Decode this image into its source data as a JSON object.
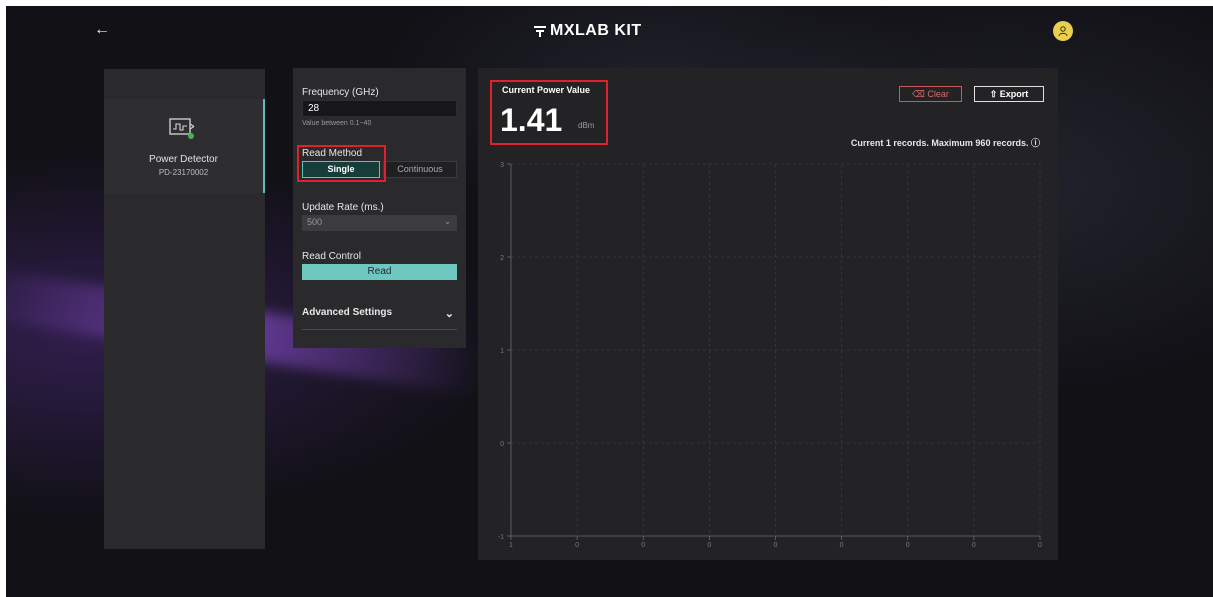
{
  "header": {
    "brand": "MXLAB KIT",
    "back_icon": "arrow-left-icon",
    "avatar_icon": "user-icon",
    "avatar_color": "#e8cf4f"
  },
  "device": {
    "name": "Power Detector",
    "serial": "PD-23170002",
    "status_color": "#4caf50"
  },
  "settings": {
    "frequency_label": "Frequency (GHz)",
    "frequency_value": "28",
    "frequency_hint": "Value between 0.1~40",
    "read_method_label": "Read Method",
    "read_method_options": [
      "Single",
      "Continuous"
    ],
    "read_method_selected": "Single",
    "update_rate_label": "Update Rate (ms.)",
    "update_rate_value": "500",
    "read_control_label": "Read Control",
    "read_button": "Read",
    "advanced_label": "Advanced Settings"
  },
  "power": {
    "title": "Current Power Value",
    "value": "1.41",
    "unit": "dBm",
    "clear_label": "Clear",
    "export_label": "Export",
    "records_text": "Current 1 records. Maximum 960 records."
  },
  "colors": {
    "accent": "#6ec8c1",
    "highlight": "#e0202a",
    "danger": "#d86a6a"
  },
  "chart_data": {
    "type": "line",
    "yticks": [
      "3",
      "2",
      "1",
      "0",
      "-1"
    ],
    "xticks": [
      "1",
      "0",
      "0",
      "0",
      "0",
      "0",
      "0",
      "0",
      "0"
    ],
    "ylim": [
      -1,
      3
    ],
    "grid": true,
    "series": []
  }
}
